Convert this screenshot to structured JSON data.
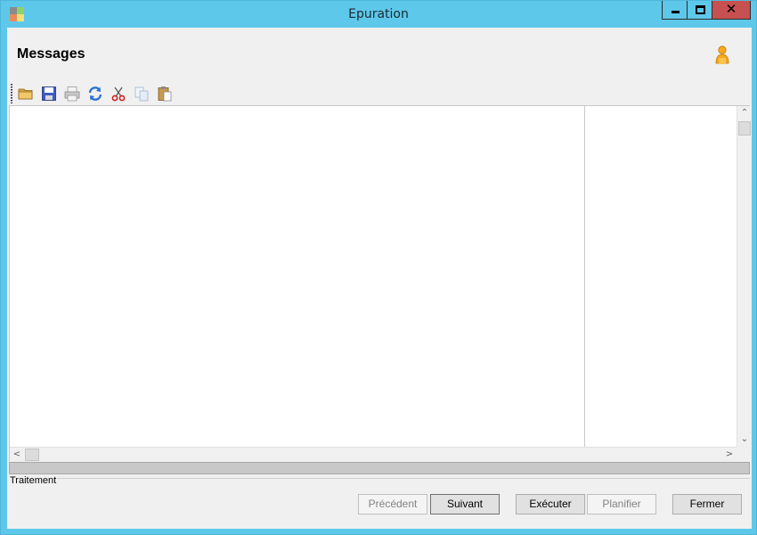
{
  "window": {
    "title": "Epuration",
    "controls": {
      "minimize": "minimize",
      "maximize": "maximize",
      "close": "✕"
    },
    "icon_colors": [
      "#8a8a8a",
      "#8fd16a",
      "#e88a5a",
      "#f3e07a"
    ]
  },
  "header": {
    "title": "Messages",
    "user_icon": "user-icon"
  },
  "toolbar": {
    "items": [
      {
        "name": "open-folder-icon",
        "enabled": true
      },
      {
        "name": "save-icon",
        "enabled": true
      },
      {
        "name": "print-icon",
        "enabled": false
      },
      {
        "name": "refresh-icon",
        "enabled": true
      },
      {
        "name": "cut-icon",
        "enabled": true
      },
      {
        "name": "copy-icon",
        "enabled": false
      },
      {
        "name": "paste-icon",
        "enabled": true
      }
    ]
  },
  "scroll": {
    "up": "⌃",
    "down": "⌄",
    "left": "<",
    "right": ">"
  },
  "progress": {
    "value": 0
  },
  "group": {
    "label": "Traitement"
  },
  "buttons": {
    "previous": {
      "label": "Précédent",
      "enabled": false
    },
    "next": {
      "label": "Suivant",
      "enabled": true
    },
    "execute": {
      "label": "Exécuter",
      "enabled": true
    },
    "schedule": {
      "label": "Planifier",
      "enabled": false
    },
    "close": {
      "label": "Fermer",
      "enabled": true
    }
  },
  "colors": {
    "titlebar": "#5ec8ea",
    "close_button": "#c75050",
    "client_bg": "#f0f0f0"
  }
}
